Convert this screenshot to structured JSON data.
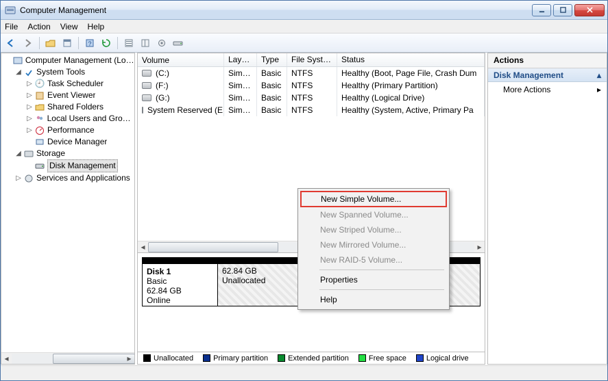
{
  "window": {
    "title": "Computer Management"
  },
  "menu": {
    "file": "File",
    "action": "Action",
    "view": "View",
    "help": "Help"
  },
  "tree": {
    "root": "Computer Management (Local",
    "sysTools": "System Tools",
    "taskSched": "Task Scheduler",
    "evtViewer": "Event Viewer",
    "shared": "Shared Folders",
    "localUsers": "Local Users and Groups",
    "perf": "Performance",
    "devmgr": "Device Manager",
    "storage": "Storage",
    "diskmgmt": "Disk Management",
    "services": "Services and Applications"
  },
  "volHeader": {
    "vol": "Volume",
    "layout": "Layout",
    "type": "Type",
    "fs": "File System",
    "status": "Status"
  },
  "vols": [
    {
      "name": "(C:)",
      "layout": "Simple",
      "type": "Basic",
      "fs": "NTFS",
      "status": "Healthy (Boot, Page File, Crash Dum"
    },
    {
      "name": "(F:)",
      "layout": "Simple",
      "type": "Basic",
      "fs": "NTFS",
      "status": "Healthy (Primary Partition)"
    },
    {
      "name": "(G:)",
      "layout": "Simple",
      "type": "Basic",
      "fs": "NTFS",
      "status": "Healthy (Logical Drive)"
    },
    {
      "name": "System Reserved (E:)",
      "layout": "Simple",
      "type": "Basic",
      "fs": "NTFS",
      "status": "Healthy (System, Active, Primary Pa"
    }
  ],
  "disk": {
    "name": "Disk 1",
    "type": "Basic",
    "size": "62.84 GB",
    "state": "Online",
    "partSize": "62.84 GB",
    "partState": "Unallocated"
  },
  "legend": {
    "unalloc": "Unallocated",
    "primary": "Primary partition",
    "extended": "Extended partition",
    "free": "Free space",
    "logical": "Logical drive"
  },
  "actions": {
    "header": "Actions",
    "section": "Disk Management",
    "more": "More Actions"
  },
  "ctx": {
    "newSimple": "New Simple Volume...",
    "newSpanned": "New Spanned Volume...",
    "newStriped": "New Striped Volume...",
    "newMirrored": "New Mirrored Volume...",
    "newRaid": "New RAID-5 Volume...",
    "properties": "Properties",
    "help": "Help"
  }
}
